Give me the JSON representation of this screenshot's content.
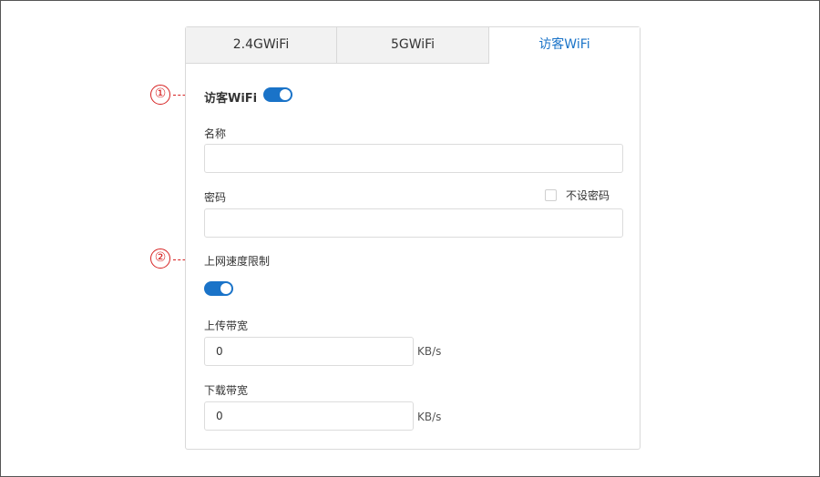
{
  "tabs": [
    {
      "label": "2.4GWiFi",
      "active": false
    },
    {
      "label": "5GWiFi",
      "active": false
    },
    {
      "label": "访客WiFi",
      "active": true
    }
  ],
  "guest_wifi": {
    "label": "访客WiFi",
    "enabled": true
  },
  "name": {
    "label": "名称",
    "value": ""
  },
  "password": {
    "label": "密码",
    "value": "",
    "no_password_label": "不设密码",
    "no_password_checked": false
  },
  "speed_limit": {
    "label": "上网速度限制",
    "enabled": true
  },
  "upload": {
    "label": "上传带宽",
    "value": "0",
    "unit": "KB/s"
  },
  "download": {
    "label": "下载带宽",
    "value": "0",
    "unit": "KB/s"
  },
  "callouts": [
    "①",
    "②"
  ],
  "colors": {
    "accent": "#1a73c8",
    "callout": "#d62020"
  }
}
